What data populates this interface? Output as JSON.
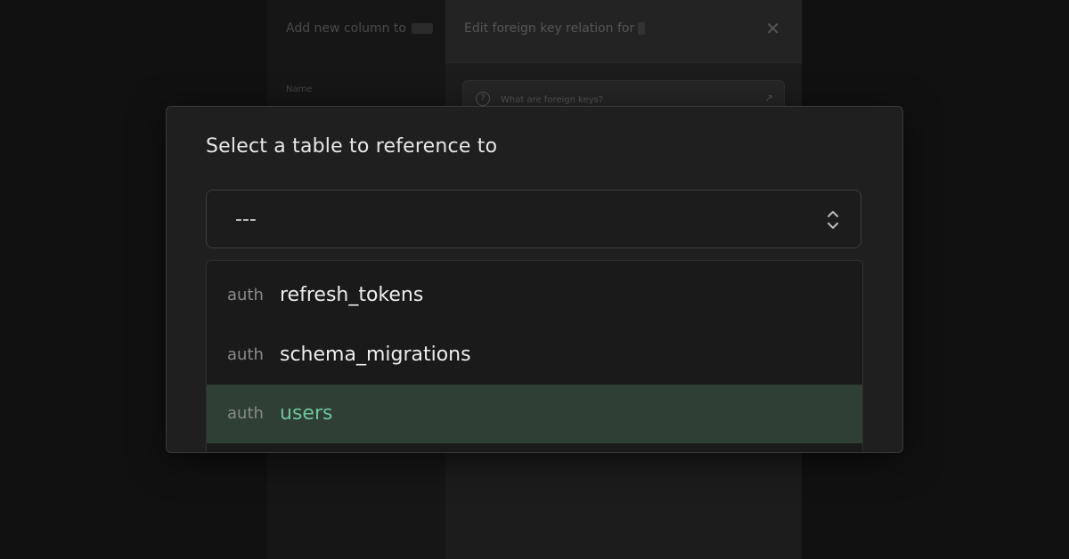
{
  "background": {
    "left_panel": {
      "title": "Add new column to",
      "field_label": "Name"
    },
    "right_panel": {
      "title": "Edit foreign key relation for",
      "close_icon": "close-icon",
      "info_text": "What are foreign keys?"
    }
  },
  "modal": {
    "title": "Select a table to reference to",
    "select": {
      "value": "---",
      "icon": "chevron-up-down-icon"
    },
    "options": [
      {
        "schema": "auth",
        "name": "refresh_tokens",
        "selected": false
      },
      {
        "schema": "auth",
        "name": "schema_migrations",
        "selected": false
      },
      {
        "schema": "auth",
        "name": "users",
        "selected": true
      }
    ]
  },
  "colors": {
    "accent": "#6fc49a",
    "selected_bg": "#2f3f34"
  }
}
